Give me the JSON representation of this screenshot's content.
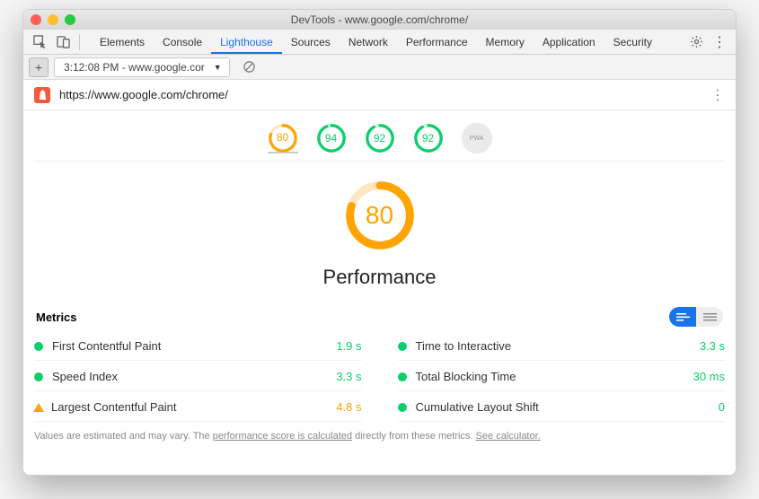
{
  "window_title": "DevTools - www.google.com/chrome/",
  "tabs": [
    "Elements",
    "Console",
    "Lighthouse",
    "Sources",
    "Network",
    "Performance",
    "Memory",
    "Application",
    "Security"
  ],
  "active_tab": "Lighthouse",
  "report_selector": "3:12:08 PM - www.google.cor",
  "url": "https://www.google.com/chrome/",
  "strip": [
    {
      "score": 80,
      "status": "avg",
      "color": "#ffa400"
    },
    {
      "score": 94,
      "status": "pass",
      "color": "#0cce6b"
    },
    {
      "score": 92,
      "status": "pass",
      "color": "#0cce6b"
    },
    {
      "score": 92,
      "status": "pass",
      "color": "#0cce6b"
    }
  ],
  "pwa_chip": "PWA",
  "main_score": 80,
  "main_title": "Performance",
  "metrics_heading": "Metrics",
  "metrics": [
    {
      "label": "First Contentful Paint",
      "value": "1.9 s",
      "status": "pass",
      "vclass": "v-green"
    },
    {
      "label": "Time to Interactive",
      "value": "3.3 s",
      "status": "pass",
      "vclass": "v-green"
    },
    {
      "label": "Speed Index",
      "value": "3.3 s",
      "status": "pass",
      "vclass": "v-green"
    },
    {
      "label": "Total Blocking Time",
      "value": "30 ms",
      "status": "pass",
      "vclass": "v-green"
    },
    {
      "label": "Largest Contentful Paint",
      "value": "4.8 s",
      "status": "avg",
      "vclass": "v-orange"
    },
    {
      "label": "Cumulative Layout Shift",
      "value": "0",
      "status": "pass",
      "vclass": "v-green"
    }
  ],
  "footnote": {
    "pre": "Values are estimated and may vary. The ",
    "link1": "performance score is calculated",
    "mid": " directly from these metrics. ",
    "link2": "See calculator."
  }
}
